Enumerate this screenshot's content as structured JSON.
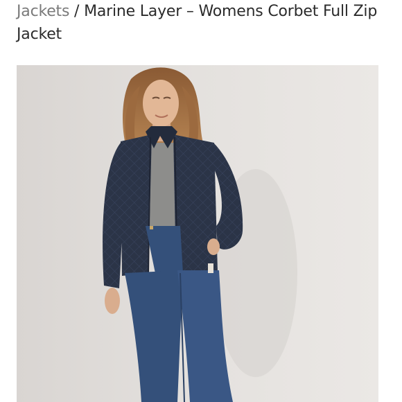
{
  "breadcrumb": {
    "parent_label": "Jackets",
    "separator": "/",
    "current_title": "Marine Layer – Womens Corbet Full Zip Jacket"
  },
  "product_image": {
    "subject": "model-wearing-navy-quilted-full-zip-jacket"
  },
  "colors": {
    "jacket": "#2b3447",
    "jeans": "#34507a",
    "background": "#e6e3e0"
  }
}
